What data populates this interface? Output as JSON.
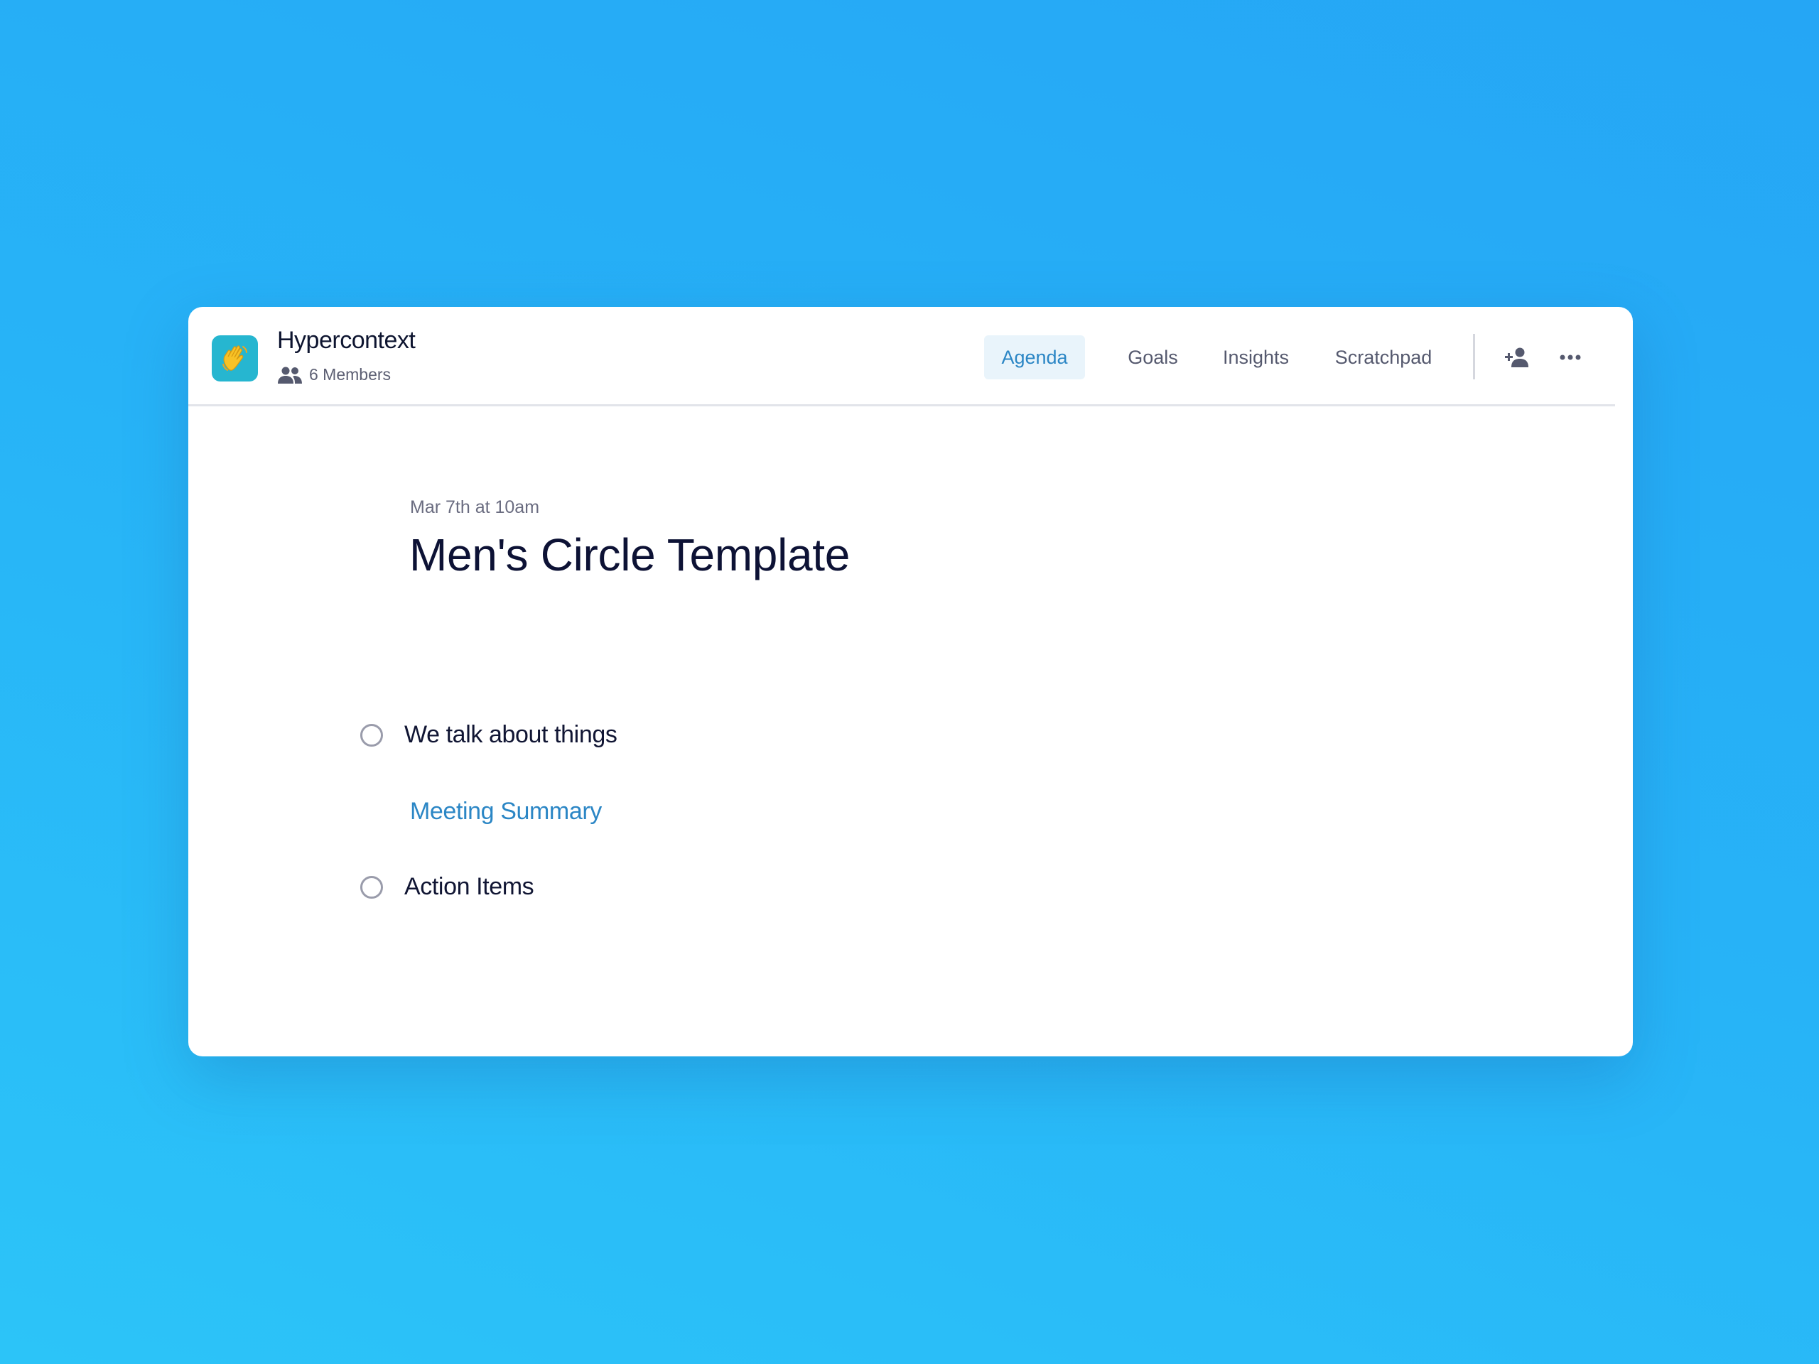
{
  "team": {
    "name": "Hypercontext",
    "logo_icon": "waving-hand-icon",
    "logo_color": "#26b6d0",
    "members_icon": "people-icon",
    "members_label": "6 Members"
  },
  "nav": {
    "tabs": [
      {
        "label": "Agenda",
        "active": true
      },
      {
        "label": "Goals",
        "active": false
      },
      {
        "label": "Insights",
        "active": false
      },
      {
        "label": "Scratchpad",
        "active": false
      }
    ],
    "add_member_icon": "add-person-icon",
    "more_icon": "more-horizontal-icon"
  },
  "meeting": {
    "date": "Mar 7th at 10am",
    "title": "Men's Circle Template"
  },
  "agenda": {
    "items": [
      {
        "label": "We talk about things",
        "checked": false
      },
      {
        "label": "Action Items",
        "checked": false
      }
    ],
    "summary_link": "Meeting Summary"
  },
  "colors": {
    "accent": "#2b86c5",
    "active_tab_bg": "#e9f4fb",
    "title_text": "#0d1235"
  }
}
